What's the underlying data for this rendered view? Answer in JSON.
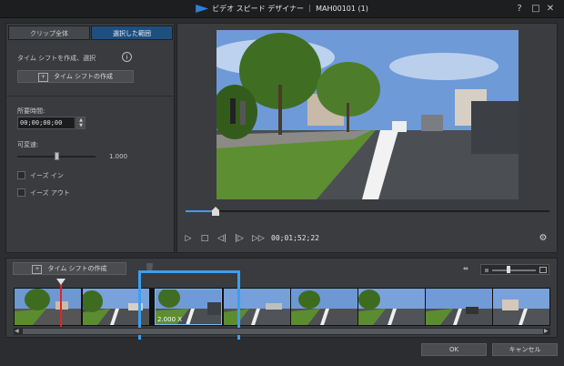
{
  "window": {
    "title": "ビデオ スピード デザイナー ｜ MAH00101 (1)",
    "help": "?",
    "minimize": "□",
    "close": "✕"
  },
  "left_panel": {
    "tabs": [
      {
        "label": "クリップ全体",
        "active": false
      },
      {
        "label": "選択した範囲",
        "active": true
      }
    ],
    "timeshift_caption": "タイム シフトを作成、選択",
    "info_icon": "ⓘ",
    "create_timeshift_label": "タイム シフトの作成",
    "duration_label": "所要時間:",
    "duration_value": "00;00;00;00",
    "speed_label": "可変速:",
    "speed_value": "1.000",
    "ease_in_label": "イーズ イン",
    "ease_out_label": "イーズ アウト"
  },
  "preview": {
    "timecode": "00;01;52;22",
    "progress": 0.08,
    "controls": [
      "play-icon",
      "stop-icon",
      "prev-frame-icon",
      "next-frame-icon",
      "fast-forward-icon"
    ]
  },
  "timeline": {
    "create_timeshift_label": "タイム シフトの作成",
    "speed_marker": "2.000 X",
    "frame_count": 8,
    "selected_frame": 2,
    "zoom_level": 0.35
  },
  "footer": {
    "ok_label": "OK",
    "cancel_label": "キャンセル"
  },
  "colors": {
    "accent": "#3a9ff2",
    "active_tab": "#1f4f7e",
    "playhead": "#e02525"
  }
}
